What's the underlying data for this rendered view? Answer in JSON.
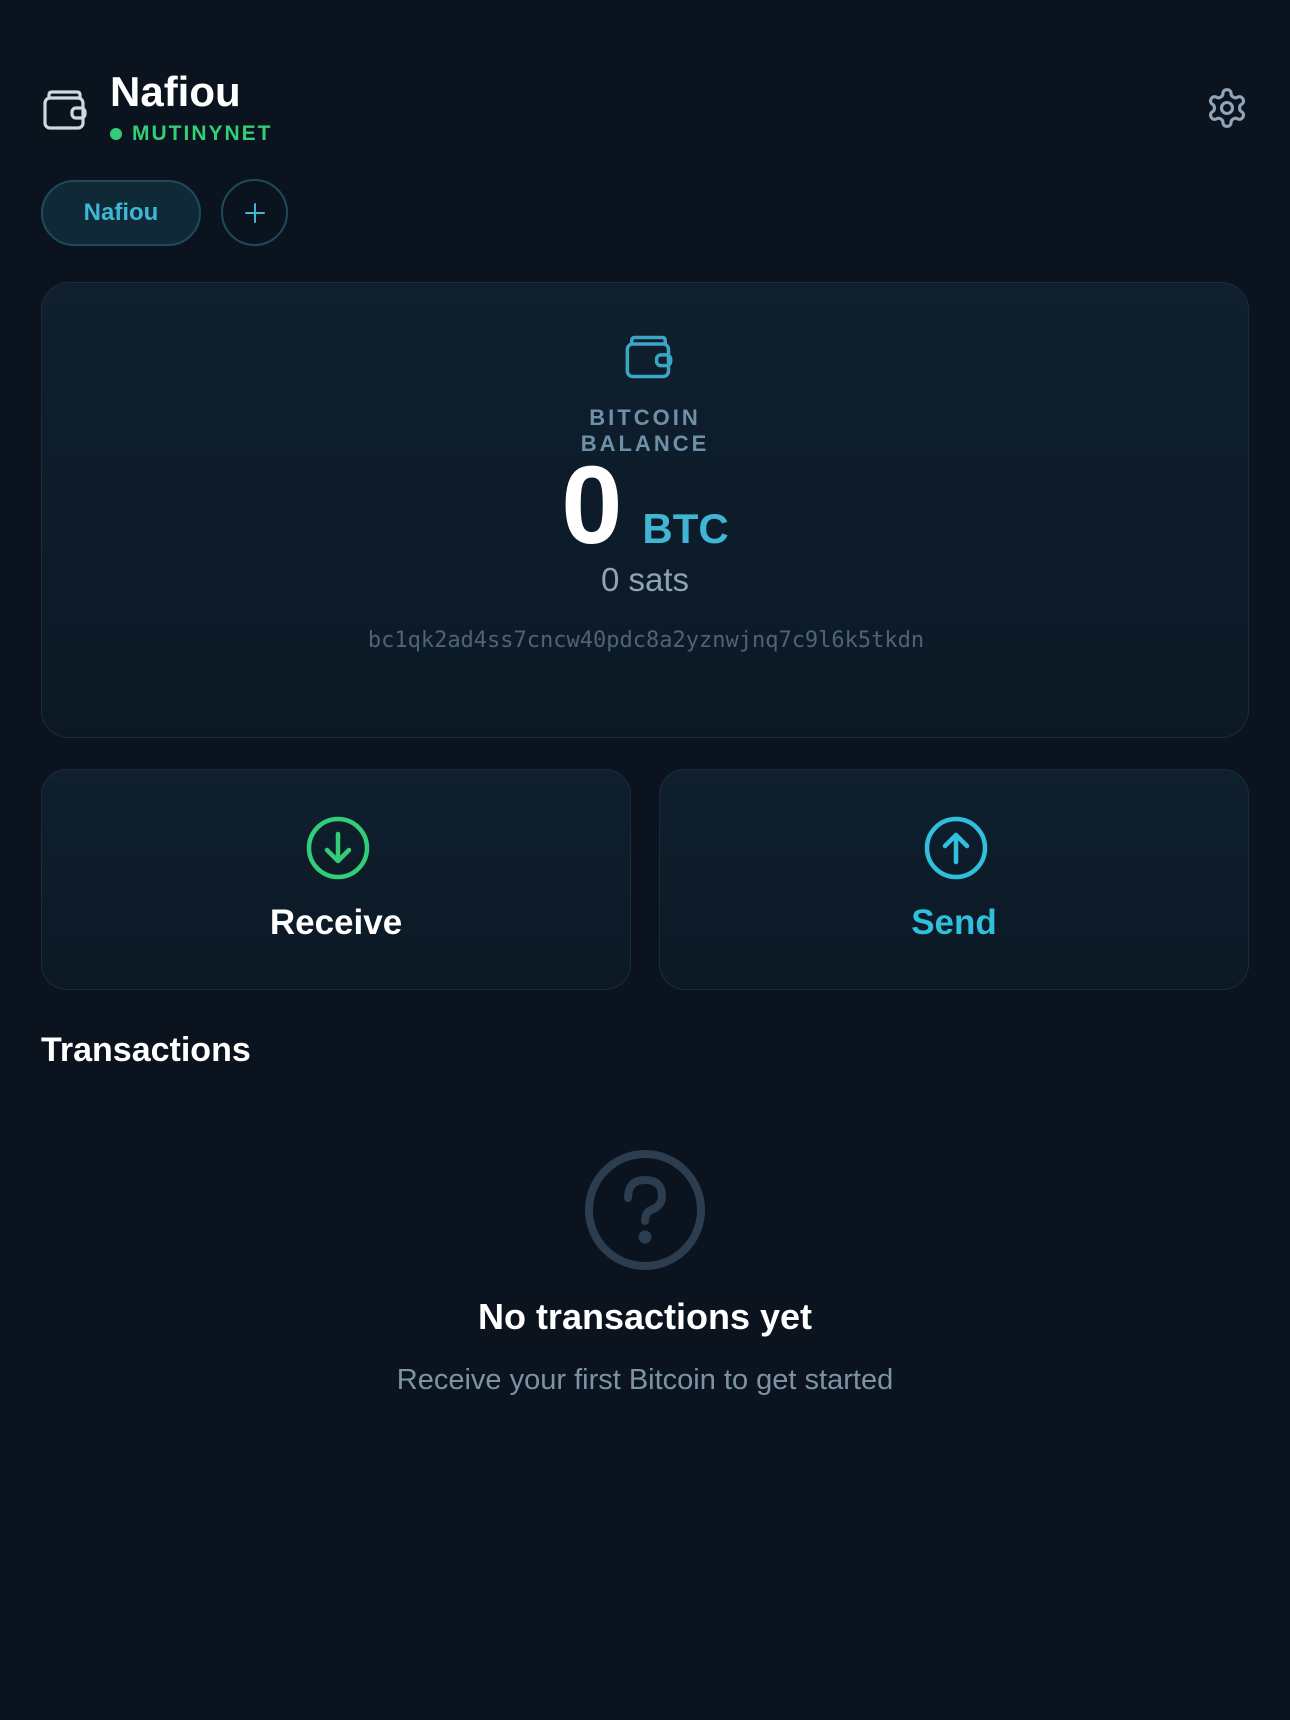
{
  "header": {
    "wallet_name": "Nafiou",
    "network": "MUTINYNET",
    "icons": {
      "wallet": "wallet-icon",
      "settings": "gear-icon"
    }
  },
  "wallet_tabs": {
    "items": [
      {
        "label": "Nafiou",
        "active": true
      }
    ],
    "add_icon": "plus-icon"
  },
  "balance": {
    "label_line1": "BITCOIN",
    "label_line2": "BALANCE",
    "amount": "0",
    "unit": "BTC",
    "sats": "0 sats",
    "address": "bc1qk2ad4ss7cncw40pdc8a2yznwjnq7c9l6k5tkdn"
  },
  "actions": {
    "receive": {
      "label": "Receive",
      "icon": "arrow-down-circle-icon"
    },
    "send": {
      "label": "Send",
      "icon": "arrow-up-circle-icon"
    }
  },
  "transactions": {
    "heading": "Transactions",
    "empty_title": "No transactions yet",
    "empty_subtitle": "Receive your first Bitcoin to get started",
    "empty_icon": "question-circle-icon"
  },
  "colors": {
    "background": "#0b141e",
    "accent": "#3fb6d3",
    "network_green": "#33cc77",
    "receive_green": "#33cc77",
    "send_cyan": "#2fc0dc",
    "muted": "#7b93a5"
  }
}
